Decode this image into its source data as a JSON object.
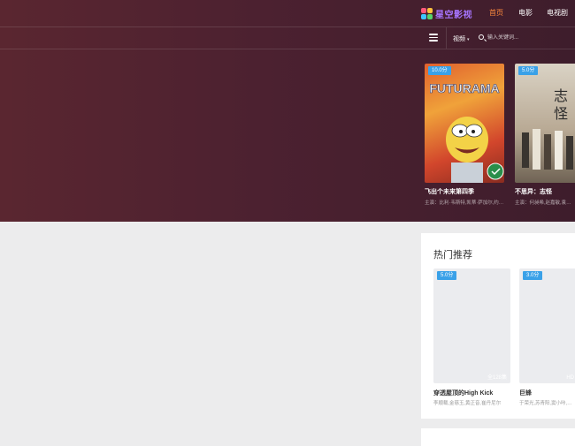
{
  "header": {
    "logo_text": "星空影视",
    "nav": [
      {
        "label": "首页",
        "active": true
      },
      {
        "label": "电影",
        "active": false
      },
      {
        "label": "电视剧",
        "active": false
      }
    ]
  },
  "subnav": {
    "category": "视频",
    "search_placeholder": "输入关键词..."
  },
  "featured": [
    {
      "score": "10.0分",
      "title": "飞出个未来第四季",
      "actors": "主演：比利·韦斯特,凯蒂·萨加尔,约翰·迪·马吉欧"
    },
    {
      "score": "5.0分",
      "title": "不思异：志怪",
      "actors": "主演：何昶希,赵嘉敏,袁冰妍"
    }
  ],
  "hot": {
    "title": "热门推荐",
    "items": [
      {
        "score": "5.0分",
        "ep": "全128集",
        "title": "穿透屋顶的High Kick",
        "actors": "李顺载,金慈玉,黄正音,崔丹尼尔"
      },
      {
        "score": "3.0分",
        "ep": "HD",
        "title": "巨蜂",
        "actors": "于荣光,苏青阳,窦小咔,周振"
      }
    ]
  },
  "colors": {
    "accent": "#ff8a3d",
    "score_badge": "#3aa1e8",
    "hero_bg": "#4c2130",
    "logo": "#a775ff"
  },
  "icons": [
    "menu-icon",
    "search-icon",
    "chevron-down-icon"
  ]
}
